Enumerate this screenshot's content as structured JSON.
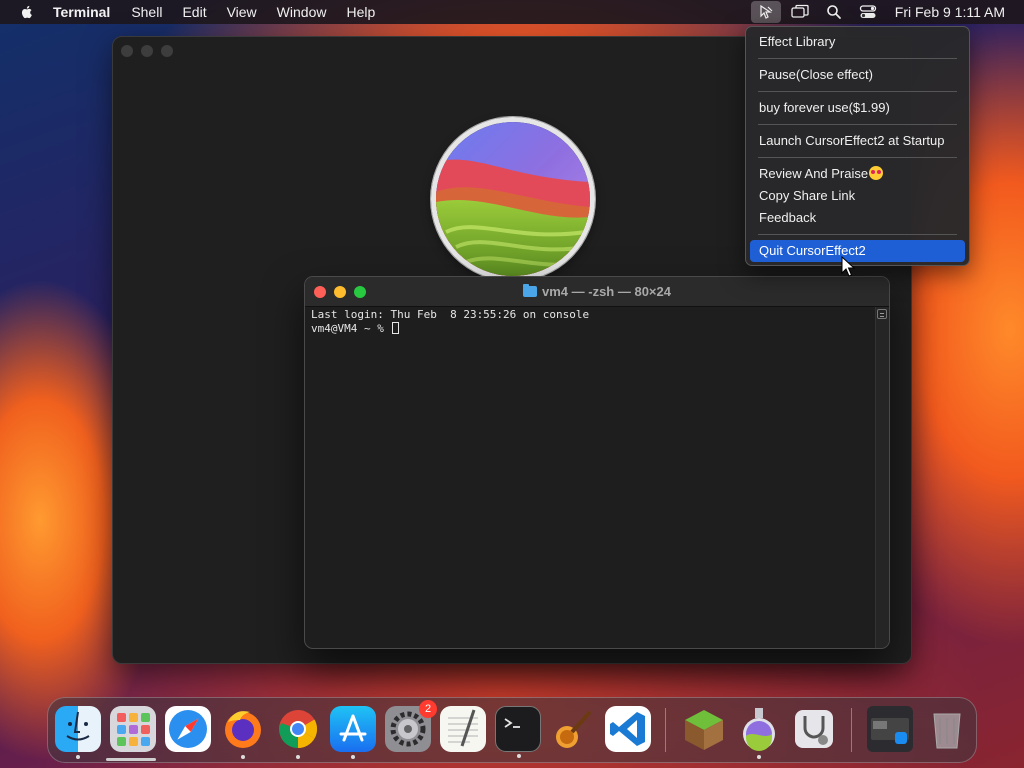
{
  "menubar": {
    "app_name": "Terminal",
    "menus": [
      "Shell",
      "Edit",
      "View",
      "Window",
      "Help"
    ],
    "clock": "Fri Feb 9  1:11 AM",
    "status_icons": [
      "cursor-effect-icon",
      "screen-mirror-icon",
      "spotlight-search-icon",
      "control-center-icon"
    ]
  },
  "terminal": {
    "title": "vm4 — -zsh — 80×24",
    "lines": [
      "Last login: Thu Feb  8 23:55:26 on console",
      "vm4@VM4 ~ % "
    ]
  },
  "dropdown": {
    "items": [
      "Effect Library",
      "Pause(Close effect)",
      "buy forever use($1.99)",
      "Launch CursorEffect2 at Startup",
      "Review And Praise",
      "Copy Share Link",
      "Feedback",
      "Quit CursorEffect2"
    ],
    "highlighted": "Quit CursorEffect2"
  },
  "dock": {
    "apps": [
      "Finder",
      "Launchpad",
      "Safari",
      "Firefox",
      "Google Chrome",
      "App Store",
      "System Settings",
      "TextEdit",
      "Terminal",
      "GarageBand",
      "Visual Studio Code",
      "Minecraft",
      "macOS Installer",
      "Disk Utility",
      "Recent Apps",
      "Trash"
    ],
    "system_settings_badge": "2"
  },
  "colors": {
    "highlight": "#1f5fd6",
    "close": "#fe5f57",
    "minimize": "#febc2e",
    "zoom": "#28c840"
  }
}
